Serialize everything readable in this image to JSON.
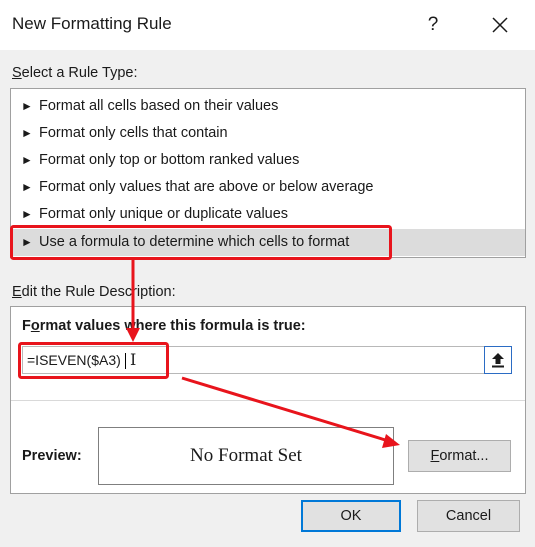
{
  "window": {
    "title": "New Formatting Rule",
    "help_label": "?",
    "close_icon": "close-icon"
  },
  "rule_type": {
    "label_key": "S",
    "label_rest": "elect a Rule Type:",
    "items": [
      {
        "arrow": "►",
        "label": "Format all cells based on their values"
      },
      {
        "arrow": "►",
        "label": "Format only cells that contain"
      },
      {
        "arrow": "►",
        "label": "Format only top or bottom ranked values"
      },
      {
        "arrow": "►",
        "label": "Format only values that are above or below average"
      },
      {
        "arrow": "►",
        "label": "Format only unique or duplicate values"
      },
      {
        "arrow": "►",
        "label": "Use a formula to determine which cells to format"
      }
    ],
    "selected_index": 5
  },
  "description": {
    "label_key": "E",
    "label_rest": "dit the Rule Description:",
    "formula_caption_pre": "F",
    "formula_caption_key": "o",
    "formula_caption_rest": "rmat values where this formula is true:",
    "formula_value": "=ISEVEN($A3)",
    "collapse_icon": "collapse-dialog-icon",
    "preview_label": "Preview:",
    "preview_text": "No Format Set",
    "format_button_key": "F",
    "format_button_rest": "ormat..."
  },
  "footer": {
    "ok_label": "OK",
    "cancel_label": "Cancel"
  },
  "annotation_color": "#e8141c",
  "ok_border_color": "#0078d7"
}
